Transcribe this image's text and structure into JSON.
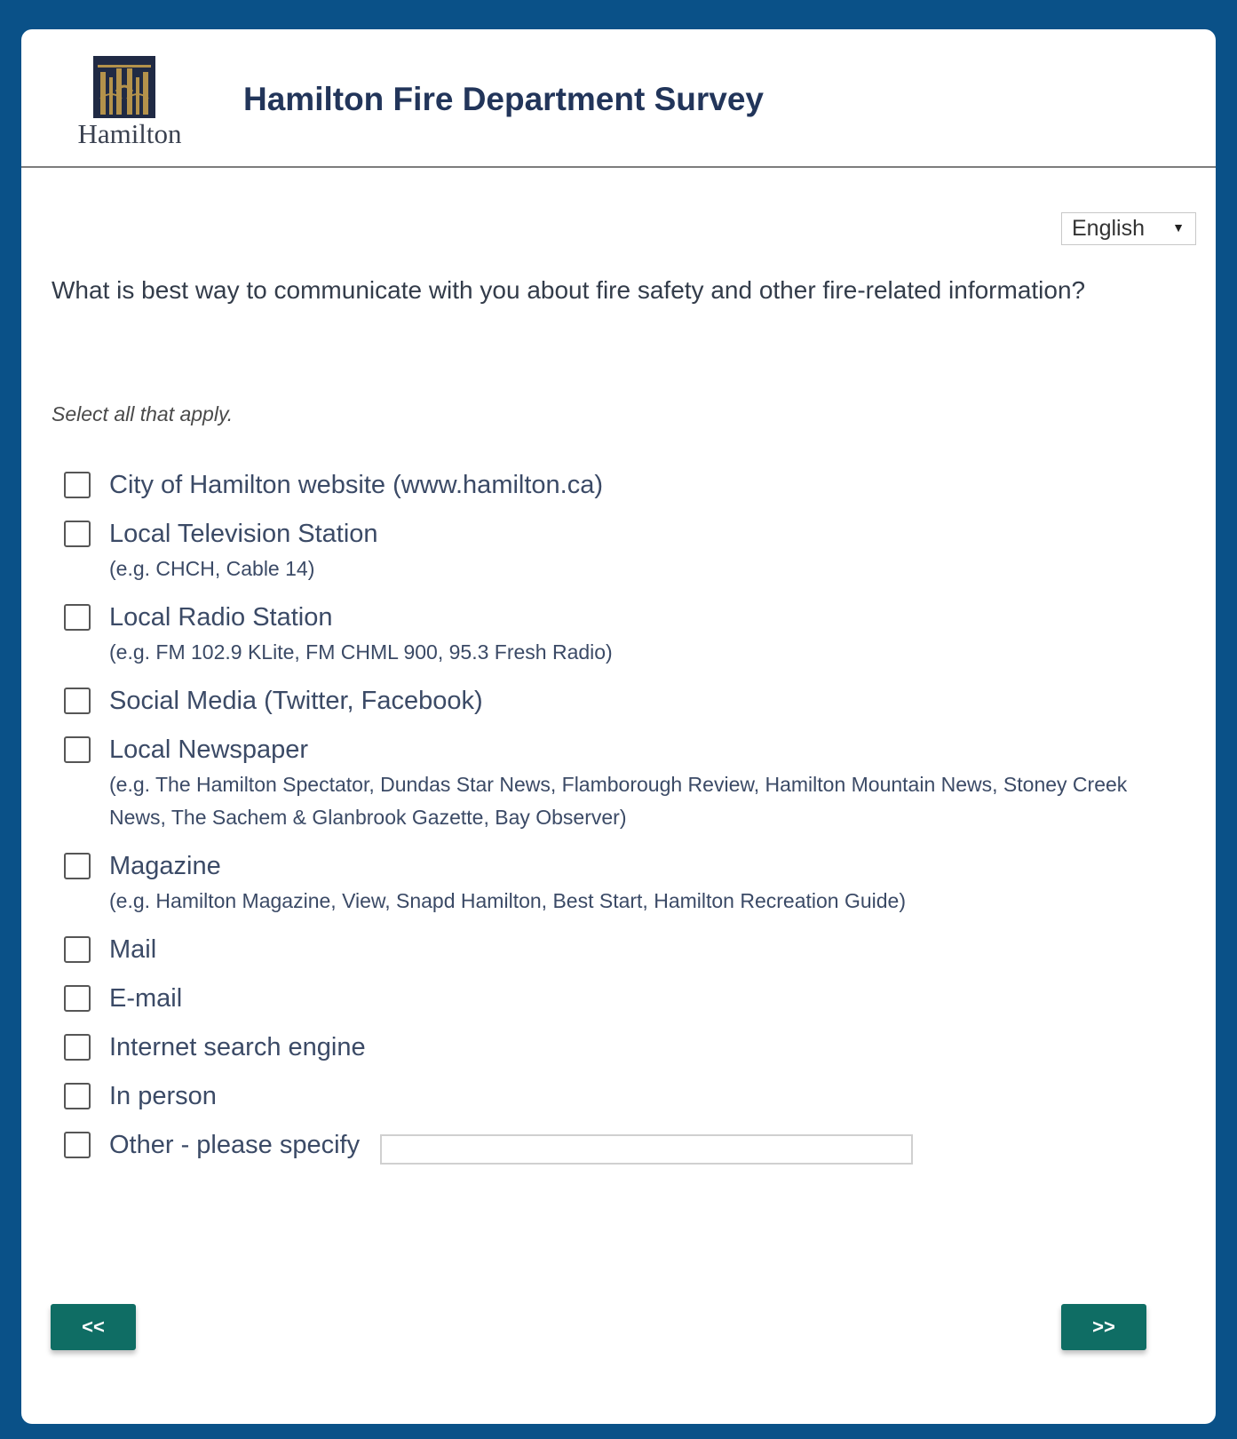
{
  "header": {
    "logo_text": "Hamilton",
    "title": "Hamilton Fire Department Survey"
  },
  "language": {
    "selected": "English"
  },
  "question": {
    "text": "What is best way to communicate with you about fire safety and other fire-related information?",
    "instruction": "Select all that apply."
  },
  "options": [
    {
      "label": "City of Hamilton website (www.hamilton.ca)"
    },
    {
      "label": "Local Television Station",
      "sub": "(e.g. CHCH, Cable 14)"
    },
    {
      "label": "Local Radio Station",
      "sub": "(e.g. FM 102.9 KLite, FM CHML 900, 95.3 Fresh Radio)"
    },
    {
      "label": "Social Media (Twitter, Facebook)"
    },
    {
      "label": "Local Newspaper",
      "sub": "(e.g. The Hamilton Spectator, Dundas Star News, Flamborough Review, Hamilton Mountain News, Stoney Creek News, The Sachem & Glanbrook Gazette, Bay Observer)"
    },
    {
      "label": "Magazine",
      "sub": "(e.g. Hamilton Magazine, View, Snapd Hamilton, Best Start, Hamilton Recreation Guide)"
    },
    {
      "label": "Mail"
    },
    {
      "label": "E-mail"
    },
    {
      "label": "Internet search engine"
    },
    {
      "label": "In person"
    },
    {
      "label": "Other - please specify"
    }
  ],
  "other_input": {
    "value": ""
  },
  "navigation": {
    "back_label": "<<",
    "next_label": ">>"
  },
  "colors": {
    "frame": "#0a5188",
    "title": "#22355a",
    "button": "#0f6d64"
  }
}
